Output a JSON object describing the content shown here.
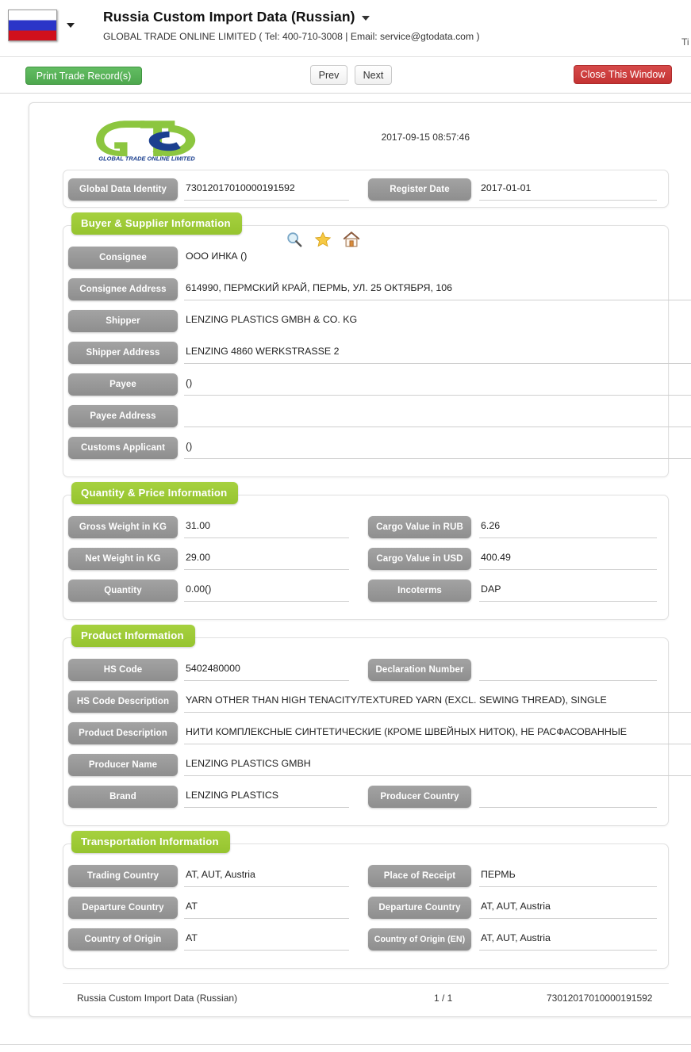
{
  "header": {
    "flag_icon": "russia-flag-icon",
    "title": "Russia Custom Import Data (Russian)",
    "subtitle": "GLOBAL TRADE ONLINE LIMITED ( Tel: 400-710-3008 | Email: service@gtodata.com )",
    "corner_clipped_text": "Ti"
  },
  "toolbar": {
    "print_label": "Print Trade Record(s)",
    "prev_label": "Prev",
    "next_label": "Next",
    "close_label": "Close This Window"
  },
  "document": {
    "logo_text_primary": "GTO",
    "logo_tagline": "GLOBAL TRADE  ONLINE LIMITED",
    "timestamp": "2017-09-15 08:57:46",
    "identity": {
      "id_label": "Global Data Identity",
      "id_value": "73012017010000191592",
      "register_date_label": "Register Date",
      "register_date_value": "2017-01-01"
    },
    "sections": [
      {
        "title": "Buyer & Supplier Information",
        "icons": [
          "search-icon",
          "star-icon",
          "home-icon"
        ],
        "rows": [
          {
            "label": "Consignee",
            "value": "ООО ИНКА ()"
          },
          {
            "label": "Consignee Address",
            "value": "614990, ПЕРМСКИЙ КРАЙ, ПЕРМЬ, УЛ. 25 ОКТЯБРЯ, 106"
          },
          {
            "label": "Shipper",
            "value": "LENZING PLASTICS GMBH & CO. KG"
          },
          {
            "label": "Shipper Address",
            "value": "LENZING 4860 WERKSTRASSE 2"
          },
          {
            "label": "Payee",
            "value": "()"
          },
          {
            "label": "Payee Address",
            "value": ""
          },
          {
            "label": "Customs Applicant",
            "value": "()"
          }
        ]
      },
      {
        "title": "Quantity & Price Information",
        "pairs": [
          {
            "left_label": "Gross Weight in KG",
            "left_value": "31.00",
            "right_label": "Cargo Value in RUB",
            "right_value": "6.26"
          },
          {
            "left_label": "Net Weight in KG",
            "left_value": "29.00",
            "right_label": "Cargo Value in USD",
            "right_value": "400.49"
          },
          {
            "left_label": "Quantity",
            "left_value": "0.00()",
            "right_label": "Incoterms",
            "right_value": "DAP"
          }
        ]
      },
      {
        "title": "Product Information",
        "hs_code_label": "HS Code",
        "hs_code_value": "5402480000",
        "declaration_label": "Declaration Number",
        "declaration_value": "",
        "hs_desc_label": "HS Code Description",
        "hs_desc_value": "YARN OTHER THAN HIGH TENACITY/TEXTURED YARN (EXCL. SEWING THREAD), SINGLE",
        "product_desc_label": "Product Description",
        "product_desc_value": "НИТИ КОМПЛЕКСНЫЕ СИНТЕТИЧЕСКИЕ (КРОМЕ ШВЕЙНЫХ НИТОК), НЕ РАСФАСОВАННЫЕ",
        "producer_label": "Producer Name",
        "producer_value": "LENZING PLASTICS GMBH",
        "brand_label": "Brand",
        "brand_value": "LENZING PLASTICS",
        "producer_country_label": "Producer Country",
        "producer_country_value": ""
      },
      {
        "title": "Transportation Information",
        "pairs": [
          {
            "left_label": "Trading Country",
            "left_value": "AT, AUT, Austria",
            "right_label": "Place of Receipt",
            "right_value": "ПЕРМЬ"
          },
          {
            "left_label": "Departure Country",
            "left_value": "AT",
            "right_label": "Departure Country",
            "right_value": "AT, AUT, Austria"
          },
          {
            "left_label": "Country of Origin",
            "left_value": "AT",
            "right_label": "Country of Origin (EN)",
            "right_value": "AT, AUT, Austria"
          }
        ]
      }
    ],
    "footer": {
      "left": "Russia Custom Import Data (Russian)",
      "page": "1 / 1",
      "right": "73012017010000191592"
    }
  },
  "colors": {
    "section_green": "#9ec93a",
    "print_green": "#4ea84e",
    "close_red": "#c43333",
    "pill_gray": "#939393"
  }
}
